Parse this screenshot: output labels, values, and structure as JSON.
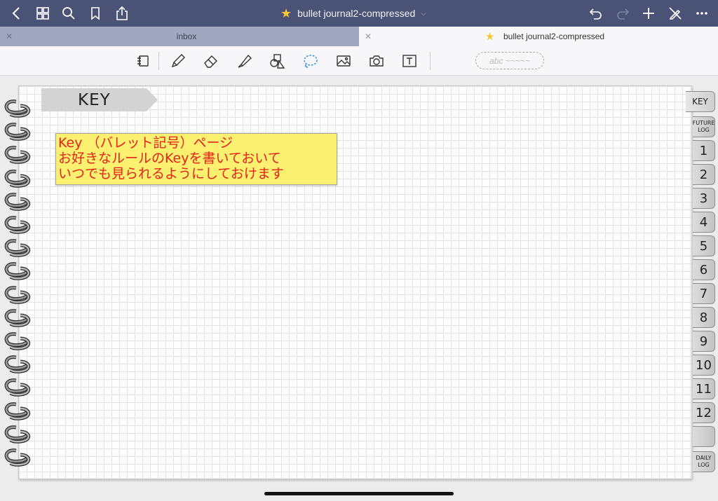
{
  "topbar": {
    "title": "bullet journal2-compressed",
    "icons": [
      "back-icon",
      "grid-icon",
      "search-icon",
      "bookmark-icon",
      "share-icon",
      "undo-icon",
      "redo-icon",
      "add-icon",
      "pen-off-icon",
      "more-icon"
    ]
  },
  "tabs": [
    {
      "label": "inbox",
      "active": false
    },
    {
      "label": "bullet journal2-compressed",
      "active": true
    }
  ],
  "toolbar": {
    "tools": [
      "read-mode-icon",
      "pen-icon",
      "eraser-icon",
      "highlighter-icon",
      "shapes-icon",
      "lasso-icon",
      "image-icon",
      "camera-icon",
      "textbox-icon"
    ],
    "ink_preview": "abc ~~~~~"
  },
  "page": {
    "banner": "KEY",
    "note_lines": [
      "Key （バレット記号）ページ",
      "お好きなルールのKeyを書いておいて",
      "いつでも見られるようにしておけます"
    ]
  },
  "index_tabs": [
    "KEY",
    "FUTURE LOG",
    "1",
    "2",
    "3",
    "4",
    "5",
    "6",
    "7",
    "8",
    "9",
    "10",
    "11",
    "12",
    "",
    "DAILY LOG"
  ],
  "colors": {
    "topbar": "#4a5275",
    "note_bg": "#fbf06f",
    "note_text": "#e3231b",
    "star": "#f5c631"
  }
}
